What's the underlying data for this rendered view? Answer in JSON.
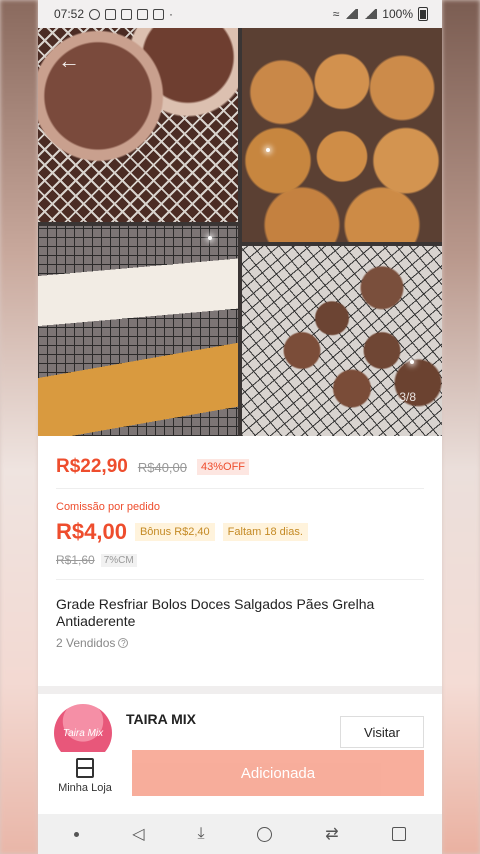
{
  "statusbar": {
    "time": "07:52",
    "battery": "100%"
  },
  "gallery": {
    "counter": "3/8"
  },
  "product": {
    "price": "R$22,90",
    "old_price": "R$40,00",
    "discount": "43%OFF",
    "commission_label": "Comissão por pedido",
    "commission": "R$4,00",
    "bonus": "Bônus R$2,40",
    "days_left": "Faltam 18 dias.",
    "commission_old": "R$1,60",
    "commission_pct": "7%CM",
    "title": "Grade Resfriar Bolos Doces Salgados Pães Grelha Antiaderente",
    "sold": "2 Vendidos"
  },
  "shop": {
    "avatar_text": "Taira Mix",
    "name": "TAIRA MIX",
    "visit_label": "Visitar",
    "store_label": "Minha Loja",
    "add_label": "Adicionada"
  },
  "colors": {
    "accent": "#ee4d2d",
    "add_button": "#f7a591",
    "avatar": "#e8577a"
  }
}
